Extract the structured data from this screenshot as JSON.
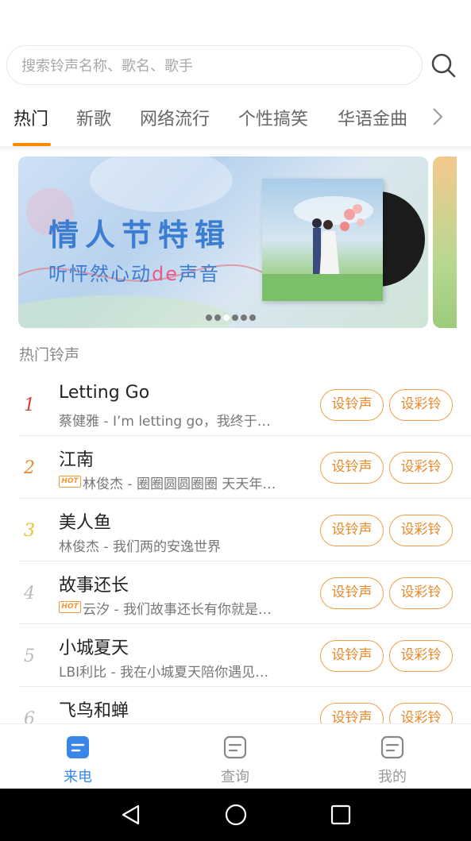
{
  "search": {
    "placeholder": "搜索铃声名称、歌名、歌手"
  },
  "tabs": [
    {
      "label": "热门",
      "active": true
    },
    {
      "label": "新歌",
      "active": false
    },
    {
      "label": "网络流行",
      "active": false
    },
    {
      "label": "个性搞笑",
      "active": false
    },
    {
      "label": "华语金曲",
      "active": false
    }
  ],
  "banner": {
    "title": "情人节特辑",
    "subtitle_prefix": "听怦然心动",
    "subtitle_highlight": "de",
    "subtitle_suffix": "声音",
    "page_count": 6,
    "active_page": 3
  },
  "section": {
    "label": "热门铃声"
  },
  "buttons": {
    "set_ringtone": "设铃声",
    "set_color_ring": "设彩铃"
  },
  "songs": [
    {
      "rank": "1",
      "title": "Letting Go",
      "subtitle": "蔡健雅 - I’m letting go，我终于…",
      "hot": false,
      "rank_color": "#d93a3a"
    },
    {
      "rank": "2",
      "title": "江南",
      "subtitle": "林俊杰 - 圈圈圆圆圈圈 天天年…",
      "hot": true,
      "rank_color": "#e8892a"
    },
    {
      "rank": "3",
      "title": "美人鱼",
      "subtitle": "林俊杰 - 我们两的安逸世界",
      "hot": false,
      "rank_color": "#e8c23a"
    },
    {
      "rank": "4",
      "title": "故事还长",
      "subtitle": "云汐 - 我们故事还长有你就是…",
      "hot": true,
      "rank_color": "#bbbbbb"
    },
    {
      "rank": "5",
      "title": "小城夏天",
      "subtitle": "LBI利比 - 我在小城夏天陪你遇见…",
      "hot": false,
      "rank_color": "#bbbbbb"
    },
    {
      "rank": "6",
      "title": "飞鸟和蝉",
      "subtitle": "",
      "hot": false,
      "rank_color": "#bbbbbb"
    }
  ],
  "hot_badge": "HOT",
  "bottom_nav": [
    {
      "label": "来电",
      "active": true
    },
    {
      "label": "查询",
      "active": false
    },
    {
      "label": "我的",
      "active": false
    }
  ],
  "colors": {
    "accent": "#ff8a00",
    "active_nav": "#3a86e8",
    "inactive_nav": "#999999",
    "banner_text": "#3b7dd0",
    "highlight": "#e85a8a"
  }
}
